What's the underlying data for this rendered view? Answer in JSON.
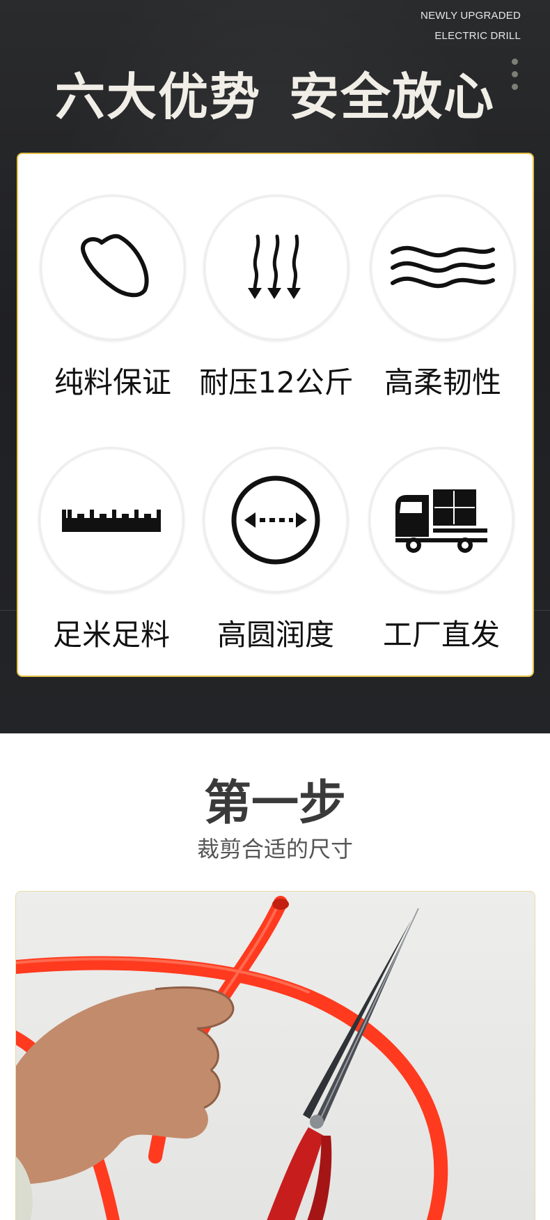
{
  "header": {
    "tag_line_1": "NEWLY UPGRADED",
    "tag_line_2": "ELECTRIC DRILL",
    "title_part_1": "六大优势",
    "title_part_2": "安全放心"
  },
  "features": [
    {
      "label": "纯料保证",
      "icon": "rice-grain-icon"
    },
    {
      "label": "耐压12公斤",
      "icon": "pressure-arrows-icon"
    },
    {
      "label": "高柔韧性",
      "icon": "waves-icon"
    },
    {
      "label": "足米足料",
      "icon": "ruler-icon"
    },
    {
      "label": "高圆润度",
      "icon": "diameter-circle-icon"
    },
    {
      "label": "工厂直发",
      "icon": "delivery-truck-icon"
    }
  ],
  "step": {
    "title": "第一步",
    "subtitle": "裁剪合适的尺寸"
  },
  "colors": {
    "hero_bg": "#222326",
    "card_border": "#e6c24a",
    "tube_red": "#ff3a1f",
    "title_light": "#f1eee7"
  }
}
